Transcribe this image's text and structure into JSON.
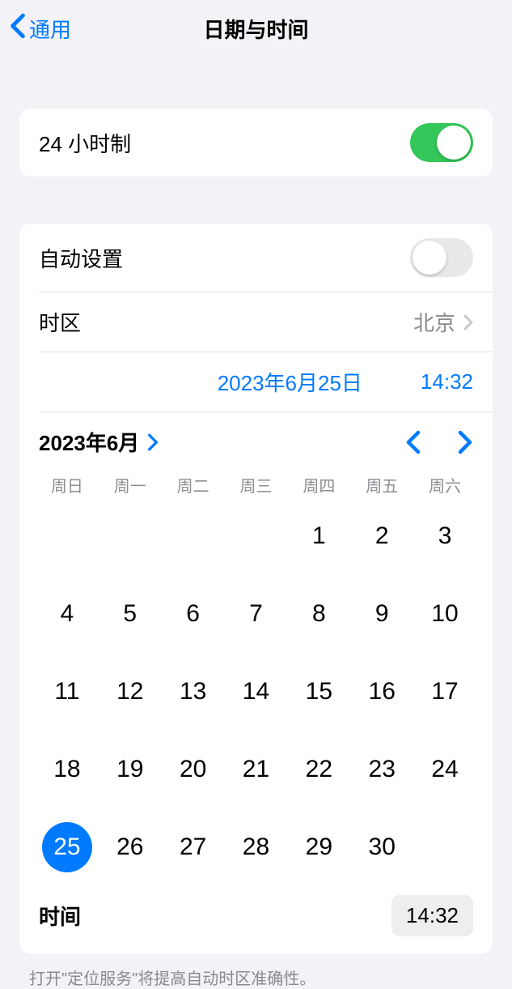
{
  "nav": {
    "back_label": "通用",
    "title": "日期与时间"
  },
  "rows": {
    "hour24_label": "24 小时制",
    "hour24_on": true,
    "auto_set_label": "自动设置",
    "auto_set_on": false,
    "timezone_label": "时区",
    "timezone_value": "北京",
    "date_value": "2023年6月25日",
    "time_value": "14:32"
  },
  "calendar": {
    "month_label": "2023年6月",
    "weekdays": [
      "周日",
      "周一",
      "周二",
      "周三",
      "周四",
      "周五",
      "周六"
    ],
    "leading_blanks": 4,
    "days": [
      1,
      2,
      3,
      4,
      5,
      6,
      7,
      8,
      9,
      10,
      11,
      12,
      13,
      14,
      15,
      16,
      17,
      18,
      19,
      20,
      21,
      22,
      23,
      24,
      25,
      26,
      27,
      28,
      29,
      30
    ],
    "selected_day": 25,
    "time_label": "时间",
    "time_value": "14:32"
  },
  "footer": {
    "note": "打开\"定位服务\"将提高自动时区准确性。"
  }
}
